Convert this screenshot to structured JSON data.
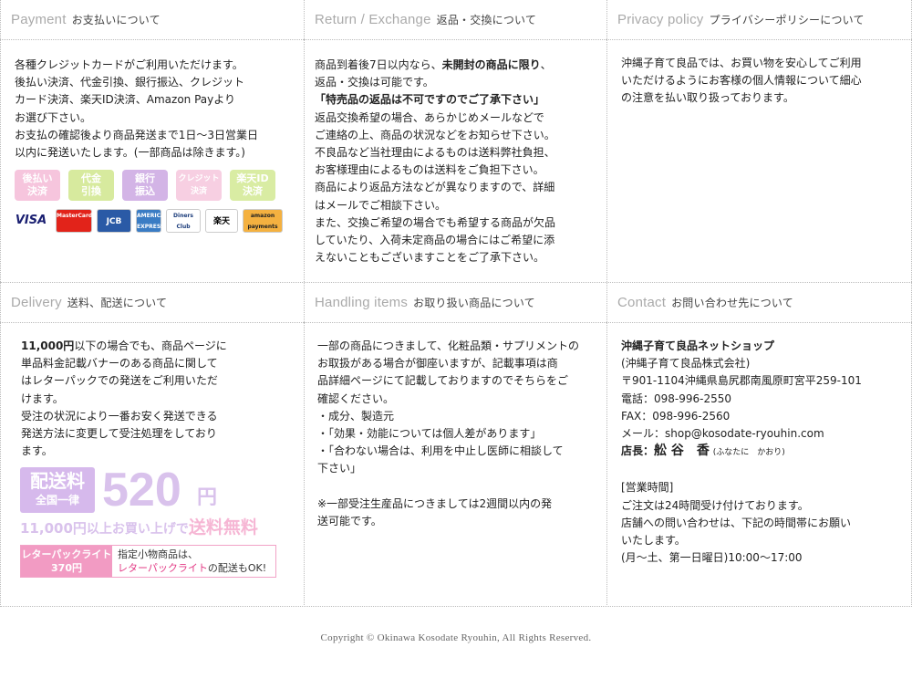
{
  "payment": {
    "en": "Payment",
    "ja": "お支払いについて",
    "text": "各種クレジットカードがご利用いただけます。\n後払い決済、代金引換、銀行振込、クレジット\nカード決済、楽天ID決済、Amazon Payより\nお選び下さい。\nお支払の確認後より商品発送まで1日〜3日営業日\n以内に発送いたします。(一部商品は除きます。)",
    "badges": [
      {
        "label": "後払い\n決済",
        "color": "#f6c5dd"
      },
      {
        "label": "代金\n引換",
        "color": "#d7ea9e"
      },
      {
        "label": "銀行\n振込",
        "color": "#d3b4e6"
      },
      {
        "label": "クレジット\n決済",
        "color": "#f7cfe2"
      },
      {
        "label": "楽天ID\n決済",
        "color": "#d9eca3"
      }
    ],
    "cards": [
      {
        "label": "VISA",
        "color": "#1a1f71",
        "bg": "#ffffff"
      },
      {
        "label": "MasterCard",
        "color": "#ffffff",
        "bg": "#e2231a"
      },
      {
        "label": "JCB",
        "color": "#ffffff",
        "bg": "#2a5aa6"
      },
      {
        "label": "AMERICAN EXPRESS",
        "color": "#ffffff",
        "bg": "#3a7cc4"
      },
      {
        "label": "Diners Club",
        "color": "#1a3b7a",
        "bg": "#ffffff"
      },
      {
        "label": "楽天",
        "color": "#000000",
        "bg": "#ffffff"
      },
      {
        "label": "amazon payments",
        "color": "#222222",
        "bg": "#f4b140"
      }
    ]
  },
  "return": {
    "en": "Return / Exchange",
    "ja": "返品・交換について",
    "line1a": "商品到着後7日以内なら、",
    "line1b": "未開封の商品に限り",
    "line1c": "、",
    "line2": "返品・交換は可能です。",
    "line3": "「特売品の返品は不可ですのでご了承下さい」",
    "text": "返品交換希望の場合、あらかじめメールなどで\nご連絡の上、商品の状況などをお知らせ下さい。\n不良品など当社理由によるものは送料弊社負担、\nお客様理由によるものは送料をご負担下さい。\n商品により返品方法などが異なりますので、詳細\nはメールでご相談下さい。\nまた、交換ご希望の場合でも希望する商品が欠品\nしていたり、入荷未定商品の場合にはご希望に添\nえないこともございますことをご了承下さい。"
  },
  "privacy": {
    "en": "Privacy policy",
    "ja": "プライバシーポリシーについて",
    "text": "沖縄子育て良品では、お買い物を安心してご利用\nいただけるようにお客様の個人情報について細心\nの注意を払い取り扱っております。"
  },
  "delivery": {
    "en": "Delivery",
    "ja": "送料、配送について",
    "amount": "11,000円",
    "text1": "以下の場合でも、商品ページに\n単品料金記載バナーのある商品に関して\nはレターパックでの発送をご利用いただ\nけます。\n受注の状況により一番お安く発送できる\n発送方法に変更して受注処理をしており\nます。",
    "banner_label1": "配送料",
    "banner_label2": "全国一律",
    "banner_price": "520",
    "banner_yen": "円",
    "free_amount": "11,000円",
    "free_mid": "以上お買い上げで",
    "free_text": "送料無料",
    "lp_label1": "レターパックライト",
    "lp_label2": "370円",
    "lp_note1": "指定小物商品は、",
    "lp_note2a": "レターパックライト",
    "lp_note2b": "の配送もOK!"
  },
  "handling": {
    "en": "Handling items",
    "ja": "お取り扱い商品について",
    "text": "一部の商品につきまして、化粧品類・サプリメントの\nお取扱がある場合が御座いますが、記載事項は商\n品詳細ページにて記載しておりますのでそちらをご\n確認ください。\n・成分、製造元\n・「効果・効能については個人差があります」\n・「合わない場合は、利用を中止し医師に相談して\n下さい」\n\n※一部受注生産品につきましては2週間以内の発\n送可能です。"
  },
  "contact": {
    "en": "Contact",
    "ja": "お問い合わせ先について",
    "shop": "沖縄子育て良品ネットショップ",
    "company": "(沖縄子育て良品株式会社)",
    "address": "〒901-1104沖縄県島尻郡南風原町宮平259-101",
    "tel": "電話：098-996-2550",
    "fax": "FAX：098-996-2560",
    "mail": "メール：shop@kosodate-ryouhin.com",
    "manager_label": "店長：",
    "manager_name": "舩 谷　香",
    "manager_kana": "(ふなたに　かおり)",
    "hours": "[営業時間]\nご注文は24時間受け付けております。\n店舗への問い合わせは、下記の時間帯にお願い\nいたします。\n(月〜土、第一日曜日)10:00〜17:00"
  },
  "footer": "Copyright © Okinawa Kosodate Ryouhin, All Rights Reserved."
}
